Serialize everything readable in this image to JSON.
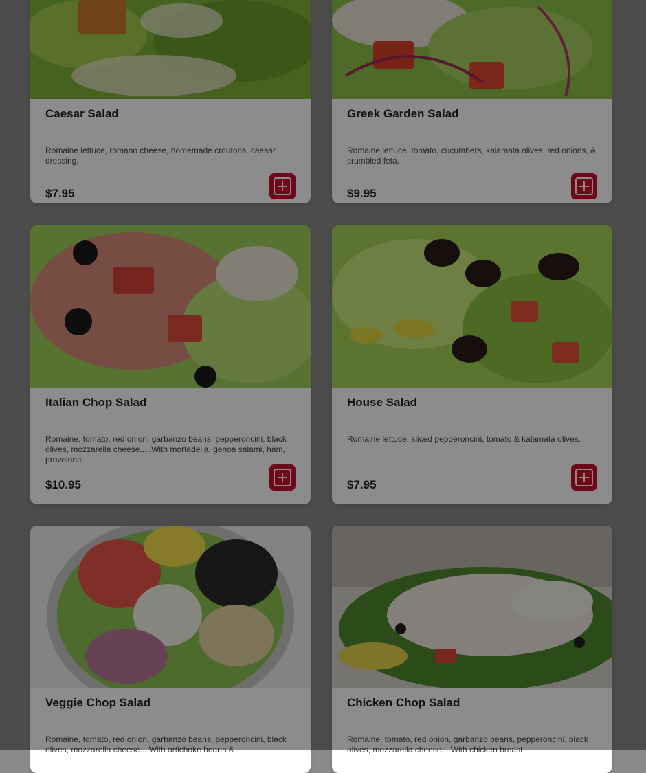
{
  "items": [
    {
      "name": "Caesar Salad",
      "description": "Romaine lettuce, romano cheese, homemade croutons, caesar dressing.",
      "price": "$7.95"
    },
    {
      "name": "Greek Garden Salad",
      "description": "Romaine lettuce, tomato, cucumbers, kalamata olives, red onions, & crumbled feta.",
      "price": "$9.95"
    },
    {
      "name": "Italian Chop Salad",
      "description": "Romaine, tomato, red onion, garbanzo beans, pepperoncini, black olives, mozzarella cheese.....With mortadella, genoa salami, ham, provolone.",
      "price": "$10.95"
    },
    {
      "name": "House Salad",
      "description": "Romaine lettuce, sliced pepperoncini, tomato & kalamata olives.",
      "price": "$7.95"
    },
    {
      "name": "Veggie Chop Salad",
      "description": "Romaine, tomato, red onion, garbanzo beans, pepperoncini, black olives, mozzarella cheese....With artichoke hearts &",
      "price": ""
    },
    {
      "name": "Chicken Chop Salad",
      "description": "Romaine, tomato, red onion, garbanzo beans, pepperoncini, black olives, mozzarella cheese....With chicken breast.",
      "price": ""
    }
  ],
  "icons": {
    "add": "plus-square-icon"
  },
  "colors": {
    "add_button": "#c8102e",
    "overlay": "rgba(0,0,0,0.45)"
  }
}
